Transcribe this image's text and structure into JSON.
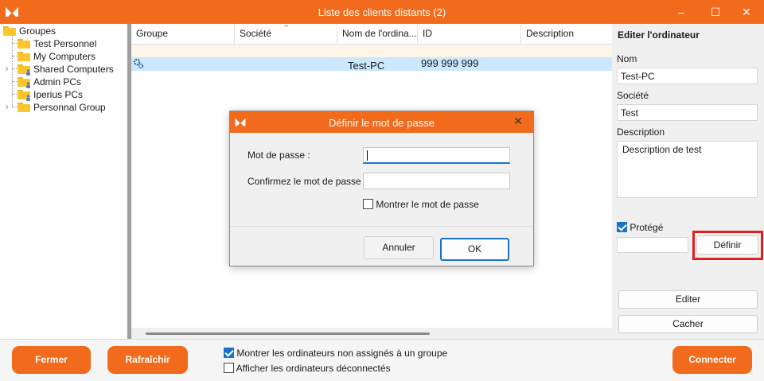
{
  "window": {
    "title": "Liste des clients distants (2)",
    "accent_color": "#f26b1d",
    "controls": {
      "minimize": "–",
      "maximize": "☐",
      "close": "✕"
    }
  },
  "tree": {
    "root": "Groupes",
    "items": [
      {
        "label": "Test Personnel",
        "expandable": false,
        "shared": false
      },
      {
        "label": "My Computers",
        "expandable": false,
        "shared": false
      },
      {
        "label": "Shared Computers",
        "expandable": true,
        "shared": true
      },
      {
        "label": "Admin PCs",
        "expandable": false,
        "shared": true
      },
      {
        "label": "Iperius PCs",
        "expandable": false,
        "shared": true
      },
      {
        "label": "Personnal Group",
        "expandable": true,
        "shared": false
      }
    ]
  },
  "grid": {
    "columns": [
      "Groupe",
      "Société",
      "Nom de l'ordina...",
      "ID",
      "Description"
    ],
    "selected_row": {
      "name": "Test-PC",
      "id": "999 999 999",
      "icon": "gear-icon"
    }
  },
  "edit_panel": {
    "title": "Editer l'ordinateur",
    "name_label": "Nom",
    "name_value": "Test-PC",
    "company_label": "Société",
    "company_value": "Test",
    "description_label": "Description",
    "description_value": "Description de test",
    "protected_label": "Protégé",
    "protected_checked": true,
    "define_button": "Définir",
    "edit_button": "Editer",
    "hide_button": "Cacher"
  },
  "bottom": {
    "close_button": "Fermer",
    "refresh_button": "Rafraîchir",
    "show_unassigned": "Montrer les ordinateurs non assignés à un groupe",
    "show_unassigned_checked": true,
    "show_disconnected": "Afficher les ordinateurs déconnectés",
    "show_disconnected_checked": false,
    "connect_button": "Connecter"
  },
  "dialog": {
    "title": "Définir le mot de passe",
    "close": "✕",
    "password_label": "Mot de passe :",
    "confirm_label": "Confirmez le mot de passe :",
    "show_password_label": "Montrer le mot de passe",
    "cancel_button": "Annuler",
    "ok_button": "OK"
  }
}
